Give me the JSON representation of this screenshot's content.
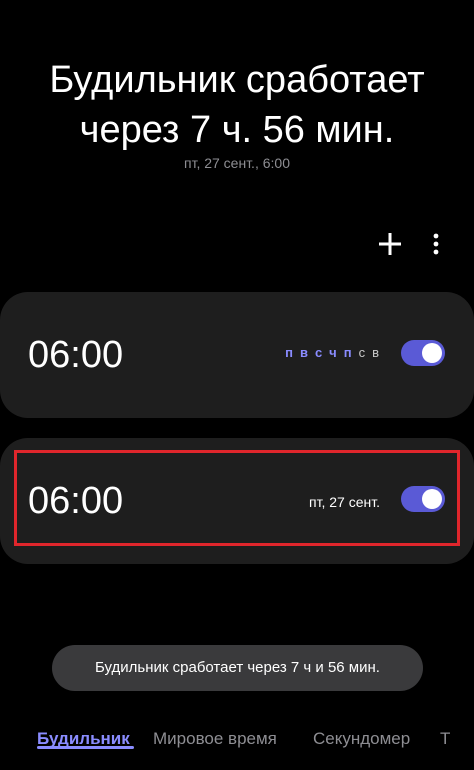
{
  "header": {
    "title_line1": "Будильник сработает",
    "title_line2": "через 7 ч. 56 мин.",
    "subtitle": "пт, 27 сент., 6:00"
  },
  "toolbar": {
    "add_icon": "plus-icon",
    "more_icon": "more-vertical-icon"
  },
  "alarms": [
    {
      "time": "06:00",
      "days": [
        {
          "label": "п",
          "active": true
        },
        {
          "label": "в",
          "active": true
        },
        {
          "label": "с",
          "active": true
        },
        {
          "label": "ч",
          "active": true
        },
        {
          "label": "п",
          "active": true
        },
        {
          "label": "с",
          "active": false
        },
        {
          "label": "в",
          "active": false
        }
      ],
      "enabled": true
    },
    {
      "time": "06:00",
      "date": "пт, 27 сент.",
      "enabled": true
    }
  ],
  "toast": {
    "text": "Будильник сработает через 7 ч и 56 мин."
  },
  "tabs": [
    {
      "label": "Будильник",
      "active": true
    },
    {
      "label": "Мировое время",
      "active": false
    },
    {
      "label": "Секундомер",
      "active": false
    },
    {
      "label": "Т",
      "active": false
    }
  ],
  "colors": {
    "accent": "#8a8cff",
    "toggle_on": "#5a5ad6",
    "card_bg": "#1e1e1e",
    "highlight": "#e0262c"
  }
}
